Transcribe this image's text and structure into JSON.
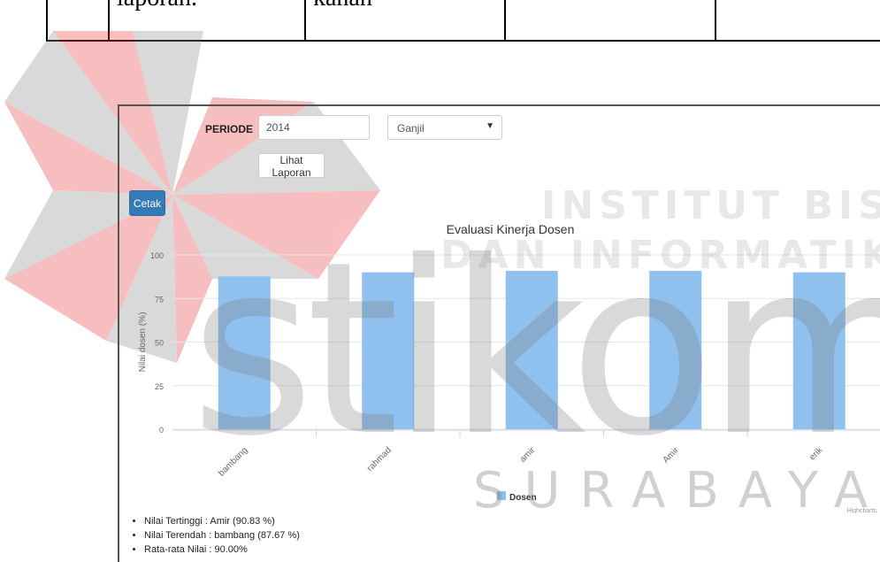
{
  "document": {
    "cell_left_text": "laporan.",
    "cell_mid_text": "kanan"
  },
  "watermark": {
    "line1": "INSTITUT BISNIS",
    "line2": "DAN INFORMATIKA",
    "brand": "stikom",
    "city": "SURABAYA"
  },
  "form": {
    "periode_label": "PERIODE",
    "year_value": "2014",
    "semester_value": "Ganjil",
    "view_button": "Lihat Laporan",
    "print_button": "Cetak"
  },
  "chart_data": {
    "type": "bar",
    "title": "Evaluasi Kinerja Dosen",
    "ylabel": "Nilai dosen (%)",
    "xlabel": "",
    "ylim": [
      0,
      100
    ],
    "yticks": [
      "0",
      "25",
      "50",
      "75",
      "100"
    ],
    "categories": [
      "bambang",
      "rahmad",
      "amir",
      "Amir",
      "erik"
    ],
    "series": [
      {
        "name": "Dosen",
        "values": [
          87.67,
          90.0,
          90.83,
          90.83,
          90.0
        ]
      }
    ],
    "bar_color": "#90c1ee",
    "legend_position": "bottom-center",
    "credits": "Highcharts.",
    "grid": true
  },
  "summary": {
    "items": [
      "Nilai Tertinggi : Amir (90.83 %)",
      "Nilai Terendah : bambang (87.67 %)",
      "Rata-rata Nilai : 90.00%"
    ]
  },
  "colors": {
    "watermark_red": "#e8383d",
    "watermark_grey": "#8c8c8c",
    "print_button": "#337ab7"
  }
}
